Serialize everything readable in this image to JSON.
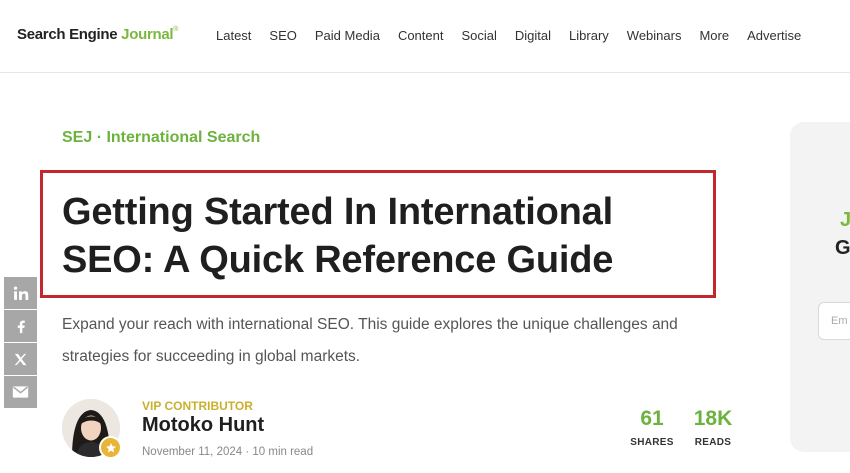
{
  "header": {
    "logo_main": "Search Engine ",
    "logo_accent": "Journal",
    "logo_mark": "®",
    "nav": [
      "Latest",
      "SEO",
      "Paid Media",
      "Content",
      "Social",
      "Digital",
      "Library",
      "Webinars",
      "More",
      "Advertise"
    ]
  },
  "article": {
    "category": "SEJ · International Search",
    "title": "Getting Started In International SEO: A Quick Reference Guide",
    "summary": "Expand your reach with international SEO. This guide explores the unique challenges and strategies for succeeding in global markets."
  },
  "share": {
    "icons": [
      "linkedin-icon",
      "facebook-icon",
      "x-icon",
      "email-icon"
    ]
  },
  "author": {
    "role": "VIP CONTRIBUTOR",
    "name": "Motoko Hunt",
    "meta": "November 11, 2024 · 10 min read"
  },
  "stats": {
    "shares_value": "61",
    "shares_label": "SHARES",
    "reads_value": "18K",
    "reads_label": "READS"
  },
  "sidebar_card": {
    "line1": "J",
    "line2": "G",
    "email_placeholder": "Em"
  },
  "colors": {
    "accent_green": "#6cb33e",
    "highlight_red": "#c1272d",
    "contributor_gold": "#c9b02f"
  }
}
